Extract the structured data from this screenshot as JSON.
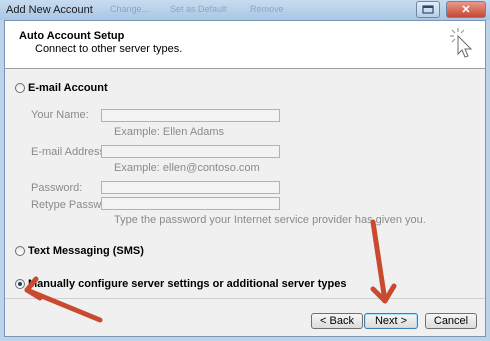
{
  "window": {
    "title": "Add New Account",
    "ghost_items": [
      "Change...",
      "Set as Default",
      "Remove"
    ],
    "close_glyph": "✕"
  },
  "header": {
    "title": "Auto Account Setup",
    "subtitle": "Connect to other server types.",
    "icon": "magic-wand-cursor-icon"
  },
  "options": {
    "email_account": "E-mail Account",
    "text_messaging": "Text Messaging (SMS)",
    "manual_config": "Manually configure server settings or additional server types",
    "selected": "manual_config"
  },
  "form": {
    "your_name_label": "Your Name:",
    "your_name_example": "Example: Ellen Adams",
    "email_label": "E-mail Address:",
    "email_example": "Example: ellen@contoso.com",
    "password_label": "Password:",
    "retype_password_label": "Retype Password:",
    "password_hint": "Type the password your Internet service provider has given you."
  },
  "buttons": {
    "back": "< Back",
    "next": "Next >",
    "cancel": "Cancel"
  },
  "colors": {
    "annotation_arrow": "#c94a2f",
    "window_chrome": "#bcd3ea"
  }
}
